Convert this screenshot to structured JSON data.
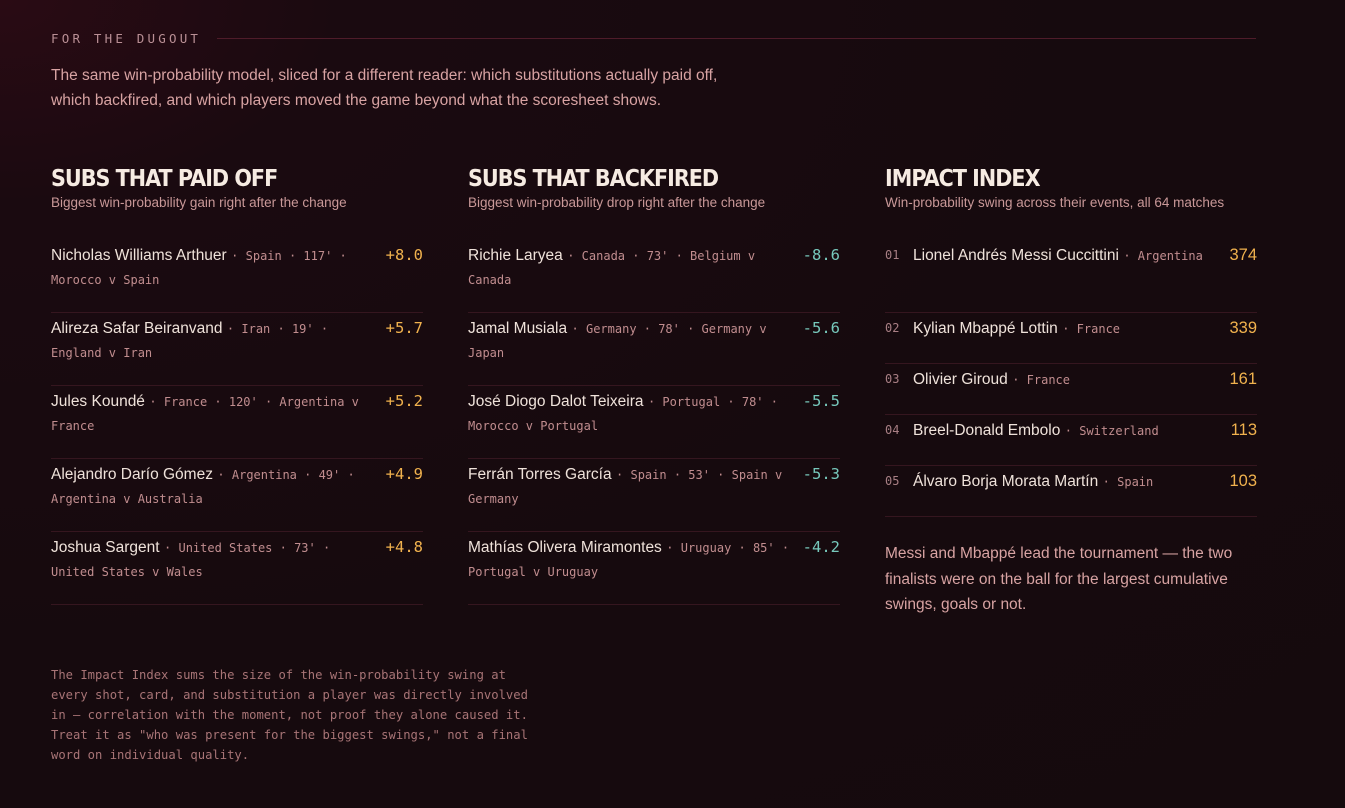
{
  "eyebrow": "FOR THE DUGOUT",
  "intro": "The same win-probability model, sliced for a different reader: which substitutions actually paid off, which backfired, and which players moved the game beyond what the scoresheet shows.",
  "paid": {
    "title": "SUBS THAT PAID OFF",
    "subtitle": "Biggest win-probability gain right after the change",
    "rows": [
      {
        "name": "Nicholas Williams Arthuer",
        "meta": "· Spain · 117' · Morocco v Spain",
        "value": "+8.0"
      },
      {
        "name": "Alireza Safar Beiranvand",
        "meta": "· Iran · 19' · England v Iran",
        "value": "+5.7"
      },
      {
        "name": "Jules Koundé",
        "meta": "· France · 120' · Argentina v France",
        "value": "+5.2"
      },
      {
        "name": "Alejandro Darío Gómez",
        "meta": "· Argentina · 49' · Argentina v Australia",
        "value": "+4.9"
      },
      {
        "name": "Joshua Sargent",
        "meta": "· United States · 73' · United States v Wales",
        "value": "+4.8"
      }
    ]
  },
  "backfired": {
    "title": "SUBS THAT BACKFIRED",
    "subtitle": "Biggest win-probability drop right after the change",
    "rows": [
      {
        "name": "Richie Laryea",
        "meta": "· Canada · 73' · Belgium v Canada",
        "value": "-8.6"
      },
      {
        "name": "Jamal Musiala",
        "meta": "· Germany · 78' · Germany v Japan",
        "value": "-5.6"
      },
      {
        "name": "José Diogo Dalot Teixeira",
        "meta": "· Portugal · 78' · Morocco v Portugal",
        "value": "-5.5"
      },
      {
        "name": "Ferrán Torres García",
        "meta": "· Spain · 53' · Spain v Germany",
        "value": "-5.3"
      },
      {
        "name": "Mathías Olivera Miramontes",
        "meta": "· Uruguay · 85' · Portugal v Uruguay",
        "value": "-4.2"
      }
    ]
  },
  "impact": {
    "title": "IMPACT INDEX",
    "subtitle": "Win-probability swing across their events, all 64 matches",
    "rows": [
      {
        "rank": "01",
        "name": "Lionel Andrés Messi Cuccittini",
        "meta": "· Argentina",
        "value": "374"
      },
      {
        "rank": "02",
        "name": "Kylian Mbappé Lottin",
        "meta": "· France",
        "value": "339"
      },
      {
        "rank": "03",
        "name": "Olivier Giroud",
        "meta": "· France",
        "value": "161"
      },
      {
        "rank": "04",
        "name": "Breel-Donald Embolo",
        "meta": "· Switzerland",
        "value": "113"
      },
      {
        "rank": "05",
        "name": "Álvaro Borja Morata Martín",
        "meta": "· Spain",
        "value": "103"
      }
    ],
    "note": "Messi and Mbappé lead the tournament — the two finalists were on the ball for the largest cumulative swings, goals or not."
  },
  "footnote": "The Impact Index sums the size of the win-probability swing at\nevery shot, card, and substitution a player was directly involved\nin — correlation with the moment, not proof they alone caused it.\nTreat it as \"who was present for the biggest swings,\" not a final\nword on individual quality.",
  "colors": {
    "positive": "#f1b24e",
    "negative": "#77c9bc",
    "background": "#160a0e"
  }
}
